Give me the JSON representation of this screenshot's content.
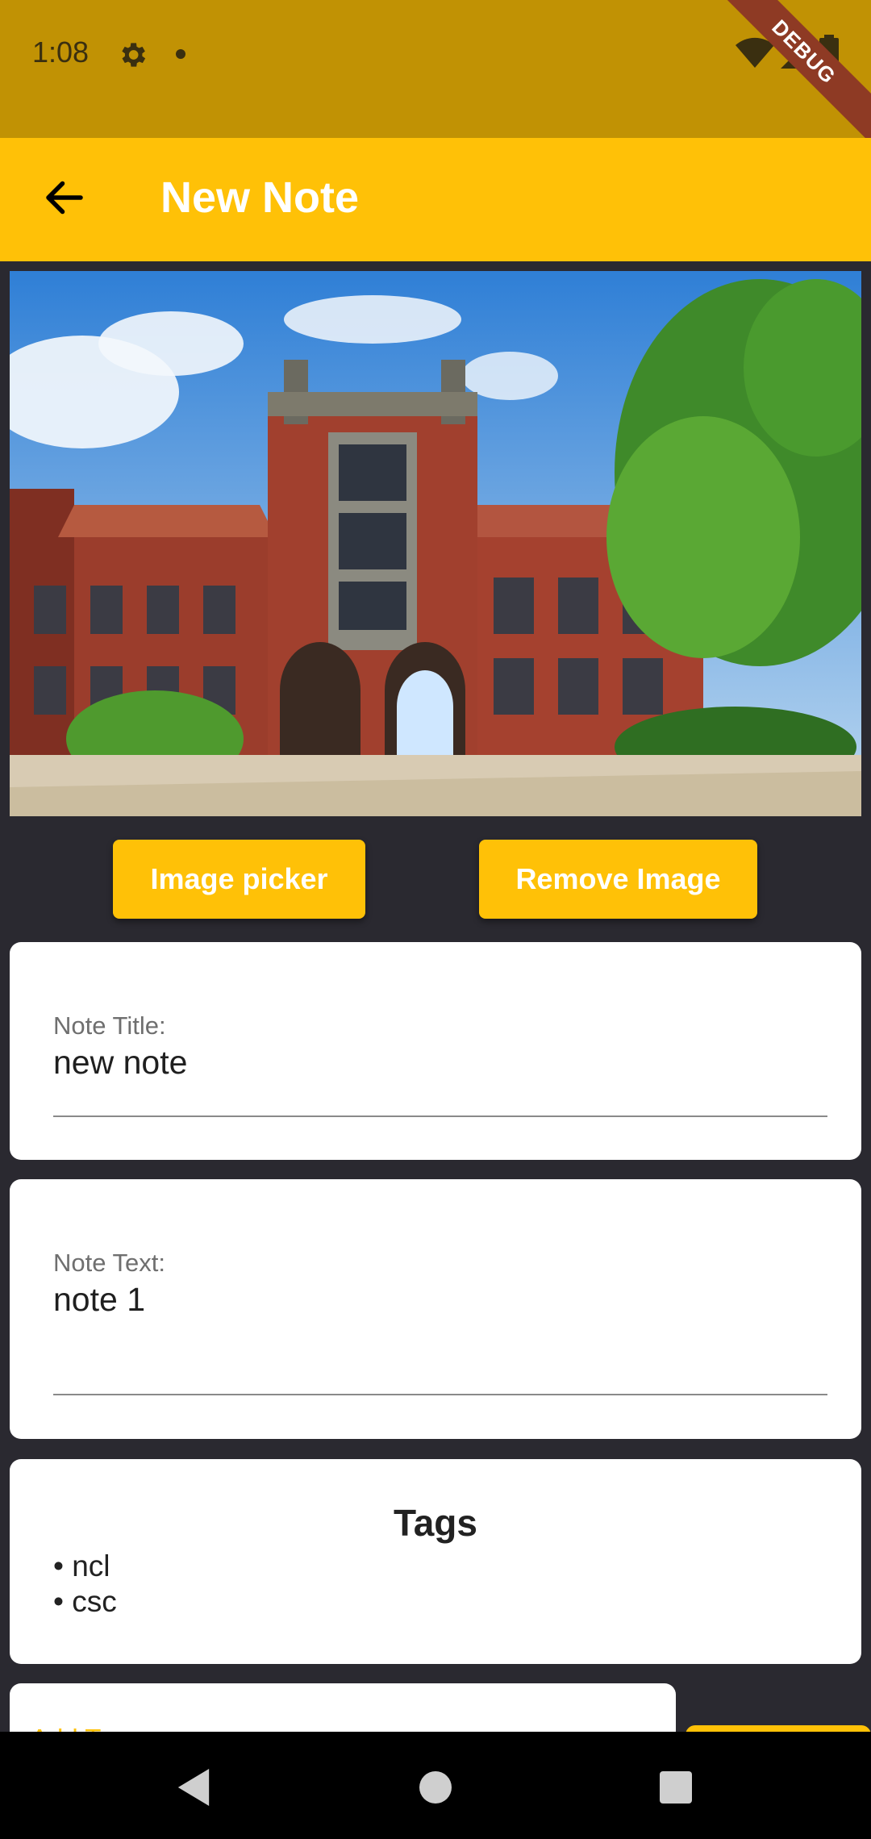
{
  "status_bar": {
    "time": "1:08",
    "debug_label": "DEBUG"
  },
  "app_bar": {
    "title": "New Note"
  },
  "buttons": {
    "image_picker": "Image picker",
    "remove_image": "Remove Image"
  },
  "note_title": {
    "label": "Note Title:",
    "value": "new note"
  },
  "note_text": {
    "label": "Note Text:",
    "value": "note 1"
  },
  "tags": {
    "heading": "Tags",
    "items": [
      "• ncl",
      "• csc"
    ]
  },
  "add_tag": {
    "placeholder": "Add T"
  },
  "colors": {
    "accent": "#ffc107",
    "status_bar": "#c19204",
    "background": "#2a2930"
  },
  "icons": [
    "back-arrow-icon",
    "gear-icon",
    "wifi-icon",
    "signal-icon",
    "battery-icon",
    "nav-back-icon",
    "nav-home-icon",
    "nav-recent-icon"
  ]
}
